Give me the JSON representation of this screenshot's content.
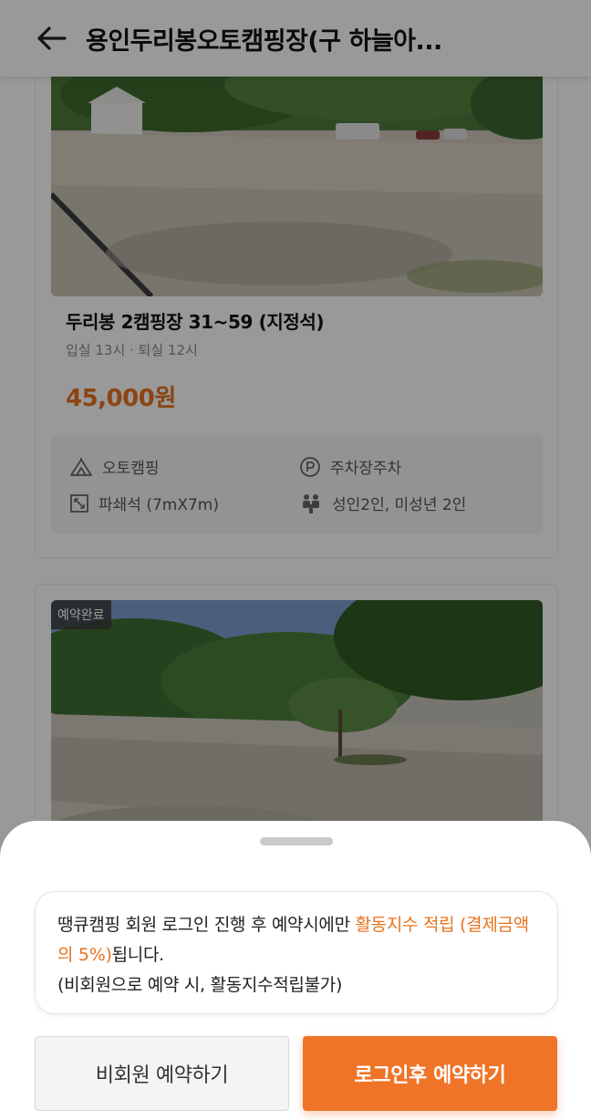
{
  "header": {
    "title": "용인두리봉오토캠핑장(구 하늘아...",
    "back_icon": "arrow-left-icon"
  },
  "cards": [
    {
      "name": "두리봉 2캠핑장 31~59 (지정석)",
      "checkin": "입실 13시 · 퇴실 12시",
      "price": "45,000원",
      "features": [
        {
          "icon": "tent-icon",
          "label": "오토캠핑"
        },
        {
          "icon": "parking-icon",
          "label": "주차장주차"
        },
        {
          "icon": "size-icon",
          "label": "파쇄석 (7mX7m)"
        },
        {
          "icon": "people-icon",
          "label": "성인2인, 미성년 2인"
        }
      ]
    },
    {
      "badge": "예약완료"
    }
  ],
  "sheet": {
    "notice_part1": "땡큐캠핑 회원 로그인 진행 후 예약시에만 ",
    "notice_highlight": "활동지수 적립 (결제금액의 5%)",
    "notice_part2": "됩니다.",
    "notice_line3": "(비회원으로 예약 시, 활동지수적립불가)",
    "guest_button": "비회원 예약하기",
    "login_button": "로그인후 예약하기"
  },
  "colors": {
    "accent": "#ef7427",
    "price": "#e8731e"
  }
}
